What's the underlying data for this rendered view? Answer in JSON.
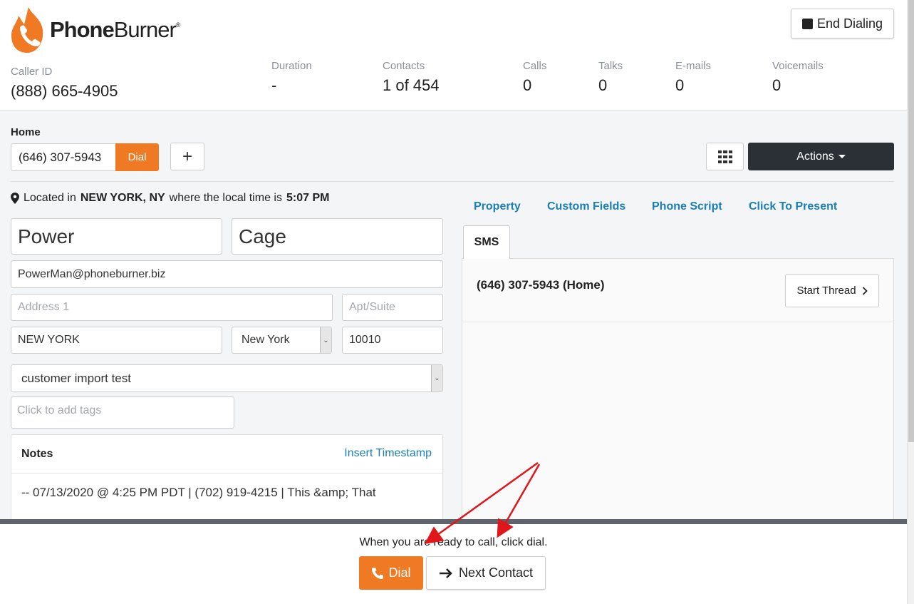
{
  "brand": {
    "name_bold": "Phone",
    "name_light": "Burner",
    "reg": "®",
    "accent": "#f07a24"
  },
  "header": {
    "end_dialing": "End Dialing",
    "caller_id": {
      "label": "Caller ID",
      "value": "(888) 665-4905"
    },
    "stats": [
      {
        "label": "Duration",
        "value": "-"
      },
      {
        "label": "Contacts",
        "value": "1 of 454"
      },
      {
        "label": "Calls",
        "value": "0"
      },
      {
        "label": "Talks",
        "value": "0"
      },
      {
        "label": "E-mails",
        "value": "0"
      },
      {
        "label": "Voicemails",
        "value": "0"
      }
    ]
  },
  "phone": {
    "label": "Home",
    "number": "(646) 307-5943",
    "dial": "Dial",
    "add": "+"
  },
  "actions": {
    "label": "Actions"
  },
  "location": {
    "prefix": "Located in",
    "place": "NEW YORK, NY",
    "middle": "where the local time is",
    "time": "5:07 PM"
  },
  "contact": {
    "first_name": "Power",
    "last_name": "Cage",
    "email": "PowerMan@phoneburner.biz",
    "address1_placeholder": "Address 1",
    "apt_placeholder": "Apt/Suite",
    "city": "NEW YORK",
    "state": "New York",
    "zip": "10010",
    "folder": "customer import test",
    "tags_placeholder": "Click to add tags"
  },
  "notes": {
    "title": "Notes",
    "insert_timestamp": "Insert Timestamp",
    "body": "-- 07/13/2020 @ 4:25 PM PDT | (702) 919-4215 | This &amp; That"
  },
  "tabs": [
    "Property",
    "Custom Fields",
    "Phone Script",
    "Click To Present"
  ],
  "sms": {
    "tab": "SMS",
    "number": "(646) 307-5943 (Home)",
    "start_thread": "Start Thread"
  },
  "bottom": {
    "message": "When you are ready to call, click dial.",
    "dial": "Dial",
    "next": "Next Contact"
  }
}
